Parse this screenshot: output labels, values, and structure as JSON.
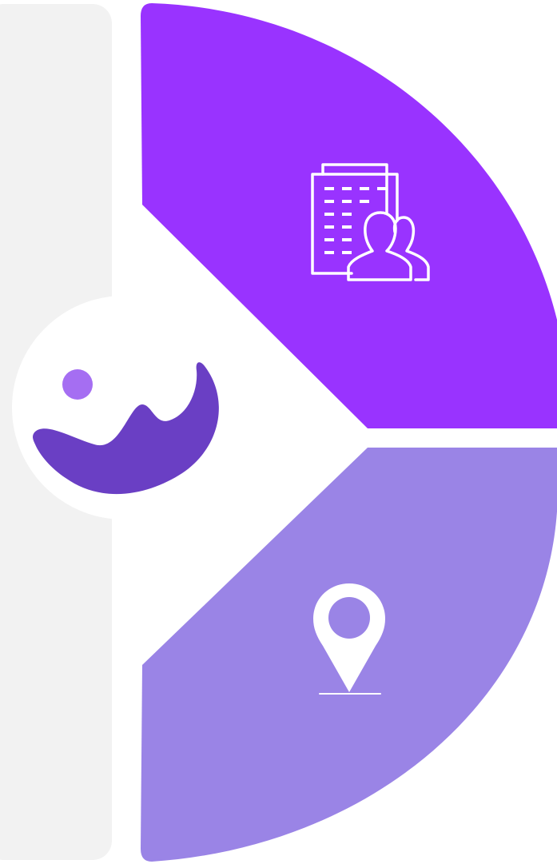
{
  "colors": {
    "background": "#ffffff",
    "left_panel": "#f2f2f2",
    "top_segment": "#9933ff",
    "bottom_segment": "#9a84e6",
    "center_disc": "#ffffff",
    "logo_dot": "#a56ef2",
    "logo_wave": "#6a3fc4",
    "icon_stroke": "#ffffff"
  },
  "icons": {
    "logo": "wave-logo-icon",
    "top_segment": "office-building-people-icon",
    "bottom_segment": "location-pin-icon"
  }
}
